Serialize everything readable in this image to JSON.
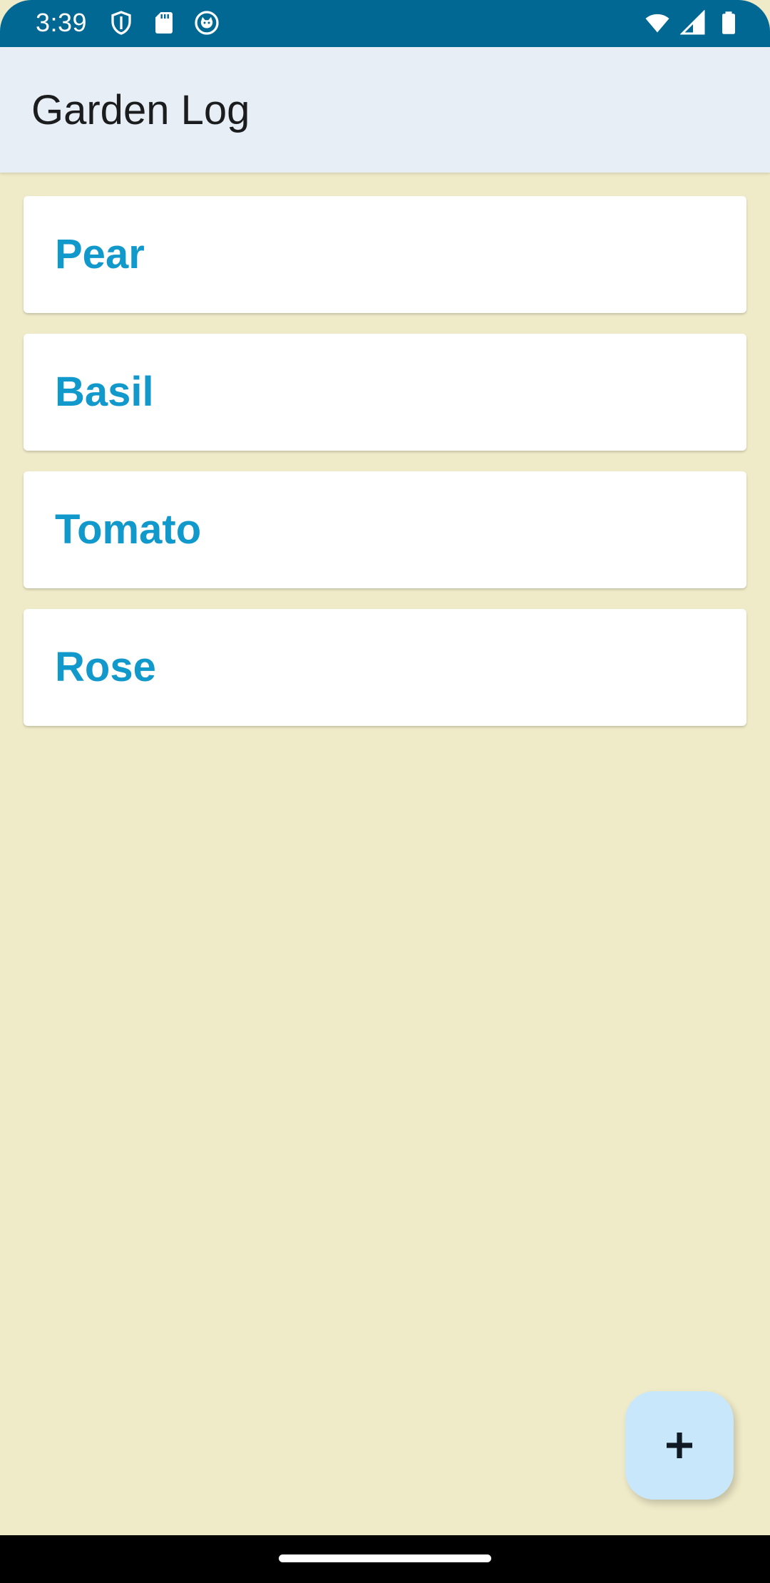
{
  "status_bar": {
    "time": "3:39",
    "left_icons": [
      "shield-icon",
      "sd-card-icon",
      "cat-face-icon"
    ],
    "right_icons": [
      "wifi-icon",
      "cell-signal-icon",
      "battery-icon"
    ],
    "color": "#006892"
  },
  "app_bar": {
    "title": "Garden Log",
    "background": "#e7eef5"
  },
  "plants": [
    {
      "name": "Pear"
    },
    {
      "name": "Basil"
    },
    {
      "name": "Tomato"
    },
    {
      "name": "Rose"
    }
  ],
  "fab": {
    "icon": "plus-icon",
    "background": "#c9e7fa"
  },
  "colors": {
    "screen_background": "#efebc8",
    "item_text": "#1199cc"
  }
}
